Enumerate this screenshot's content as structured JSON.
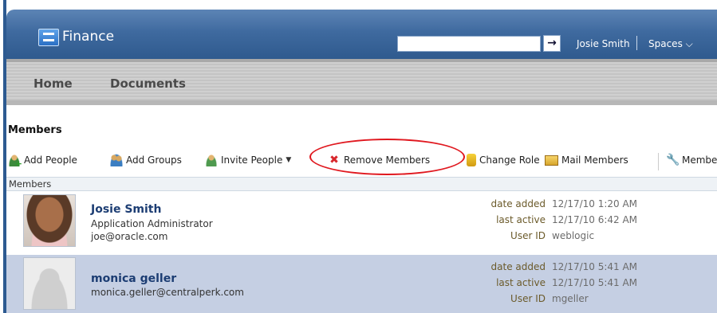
{
  "header": {
    "app_title": "Finance",
    "search_value": "",
    "search_go_glyph": "→",
    "user_name": "Josie Smith",
    "spaces_label": "Spaces ⌵"
  },
  "nav": {
    "tabs": [
      "Home",
      "Documents"
    ]
  },
  "section_title": "Members",
  "toolbar": {
    "add_people": "Add People",
    "add_groups": "Add Groups",
    "invite_people": "Invite People",
    "remove_members": "Remove Members",
    "change_role": "Change Role",
    "mail_members": "Mail Members",
    "members_more": "Member"
  },
  "table": {
    "header": "Members",
    "labels": {
      "date_added": "date added",
      "last_active": "last active",
      "user_id": "User ID"
    },
    "rows": [
      {
        "name": "Josie Smith",
        "role": "Application Administrator",
        "email": "joe@oracle.com",
        "date_added": "12/17/10 1:20 AM",
        "last_active": "12/17/10 6:42 AM",
        "user_id": "weblogic"
      },
      {
        "name": "monica geller",
        "email": "monica.geller@centralperk.com",
        "date_added": "12/17/10 5:41 AM",
        "last_active": "12/17/10 5:41 AM",
        "user_id": "mgeller"
      }
    ]
  },
  "colors": {
    "header_blue": "#3f6a9f",
    "name_blue": "#1c3d73",
    "selected_row": "#c5cfe3",
    "highlight_red": "#e0181f"
  },
  "icons": [
    "logo-icon",
    "arrow-right-icon",
    "add-person-icon",
    "add-group-icon",
    "invite-person-icon",
    "remove-x-icon",
    "lock-icon",
    "mail-icon",
    "wrench-icon"
  ]
}
